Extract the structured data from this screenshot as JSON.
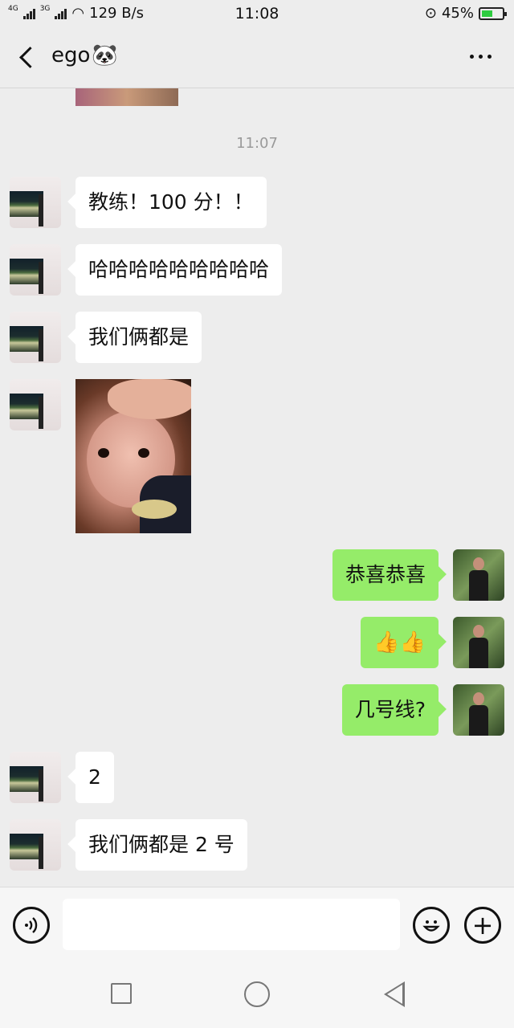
{
  "status_bar": {
    "sig1": "4G",
    "sig2": "3G",
    "speed": "129 B/s",
    "time": "11:08",
    "battery": "45%",
    "battery_level": 0.45
  },
  "header": {
    "title": "ego",
    "title_emoji": "🐼"
  },
  "chat": {
    "timestamp": "11:07",
    "messages": [
      {
        "from": "friend",
        "text": "教练！100 分！！"
      },
      {
        "from": "friend",
        "text": "哈哈哈哈哈哈哈哈哈"
      },
      {
        "from": "friend",
        "text": "我们俩都是"
      },
      {
        "from": "friend",
        "type": "image"
      },
      {
        "from": "me",
        "text": "恭喜恭喜"
      },
      {
        "from": "me",
        "text": "👍👍"
      },
      {
        "from": "me",
        "text": "几号线?"
      },
      {
        "from": "friend",
        "text": "2"
      },
      {
        "from": "friend",
        "text": "我们俩都是 2 号"
      }
    ]
  },
  "input_bar": {
    "voice_icon": "voice-icon",
    "emoji_icon": "emoji-icon",
    "plus_icon": "plus-icon",
    "input_value": ""
  },
  "colors": {
    "background": "#ededed",
    "bubble_in": "#ffffff",
    "bubble_out": "#95ec69"
  }
}
